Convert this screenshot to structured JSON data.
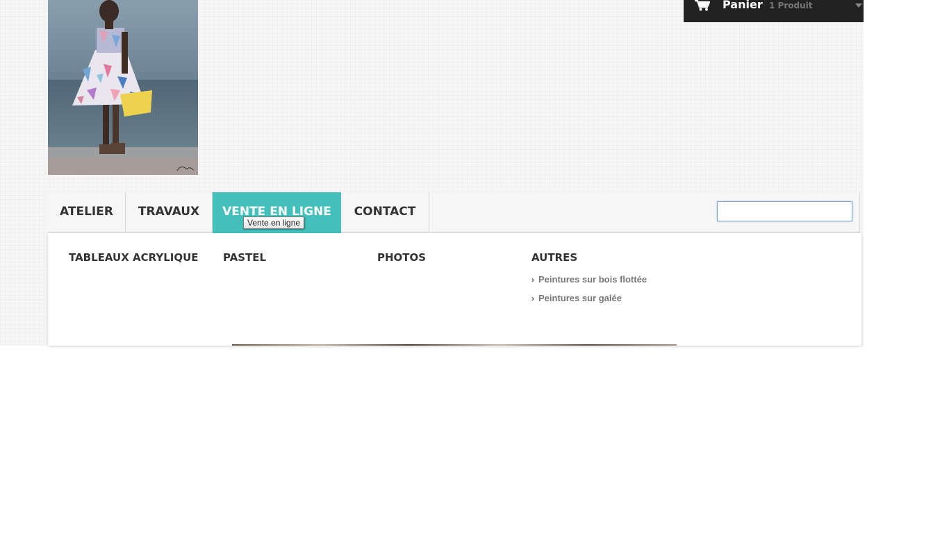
{
  "logo": {
    "icon": "painting-woman-at-sea",
    "alt_signature": "C.Griffe"
  },
  "cart": {
    "icon": "shopping-cart-icon",
    "title": "Panier",
    "count_label": "1 Produit",
    "caret_icon": "caret-down-icon"
  },
  "menu": {
    "items": [
      {
        "label": "ATELIER"
      },
      {
        "label": "TRAVAUX"
      },
      {
        "label": "VENTE EN LIGNE",
        "active": true
      },
      {
        "label": "CONTACT"
      }
    ],
    "active_color": "#44c0bc",
    "search": {
      "value": "",
      "placeholder": ""
    }
  },
  "tooltip": {
    "text": "Vente en ligne"
  },
  "dropdown": {
    "columns": [
      {
        "title": "TABLEAUX ACRYLIQUE"
      },
      {
        "title": "PASTEL"
      },
      {
        "title": "PHOTOS"
      },
      {
        "title": "AUTRES",
        "links": [
          {
            "label": "Peintures sur bois flottée"
          },
          {
            "label": "Peintures sur galée"
          }
        ]
      }
    ]
  }
}
